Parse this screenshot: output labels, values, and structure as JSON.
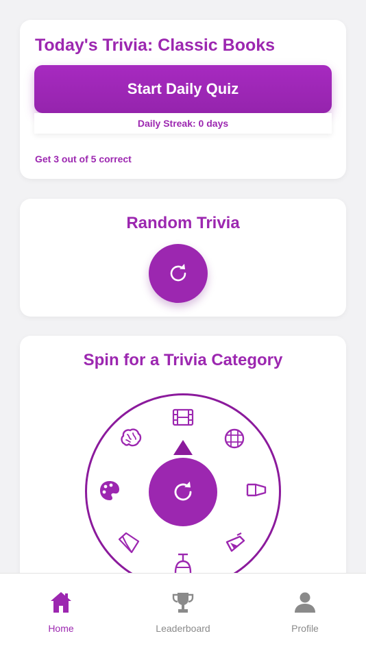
{
  "daily": {
    "title": "Today's Trivia: Classic Books",
    "start_label": "Start Daily Quiz",
    "streak": "Daily Streak: 0 days",
    "goal": "Get 3 out of 5 correct"
  },
  "random": {
    "title": "Random Trivia",
    "icon": "refresh-icon"
  },
  "spin": {
    "title": "Spin for a Trivia Category",
    "categories": [
      "film-icon",
      "globe-icon",
      "science-icon",
      "sports-icon",
      "sports-trophy-icon",
      "literature-icon",
      "art-icon",
      "brain-icon"
    ],
    "center_icon": "refresh-icon"
  },
  "tabs": [
    {
      "label": "Home",
      "icon": "home-icon",
      "active": true
    },
    {
      "label": "Leaderboard",
      "icon": "trophy-icon",
      "active": false
    },
    {
      "label": "Profile",
      "icon": "user-icon",
      "active": false
    }
  ],
  "colors": {
    "accent": "#9c27b0",
    "wheel": "#8b1a9c",
    "inactive": "#8a8a8a",
    "background": "#f2f2f4"
  }
}
